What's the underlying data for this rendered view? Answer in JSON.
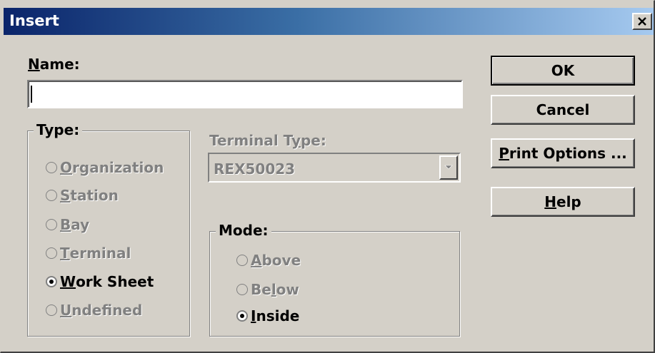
{
  "window": {
    "title": "Insert",
    "close_glyph": "✕"
  },
  "name_field": {
    "label_underlined": "N",
    "label_rest": "ame:",
    "value": ""
  },
  "type_group": {
    "title": "Type:",
    "options": [
      {
        "underlined": "O",
        "rest": "rganization",
        "selected": false,
        "enabled": false
      },
      {
        "underlined": "S",
        "rest": "tation",
        "selected": false,
        "enabled": false
      },
      {
        "underlined": "B",
        "rest": "ay",
        "selected": false,
        "enabled": false
      },
      {
        "underlined": "T",
        "rest": "erminal",
        "selected": false,
        "enabled": false
      },
      {
        "underlined": "W",
        "rest": "ork Sheet",
        "selected": true,
        "enabled": true
      },
      {
        "underlined": "U",
        "rest": "ndefined",
        "selected": false,
        "enabled": false
      }
    ]
  },
  "terminal_type": {
    "label_before": "Terminal T",
    "label_underlined": "y",
    "label_after": "pe:",
    "value": "REX50023"
  },
  "mode_group": {
    "title": "Mode:",
    "options": [
      {
        "before": "",
        "underlined": "A",
        "rest": "bove",
        "selected": false,
        "enabled": false
      },
      {
        "before": "Be",
        "underlined": "l",
        "rest": "ow",
        "selected": false,
        "enabled": false
      },
      {
        "before": "",
        "underlined": "I",
        "rest": "nside",
        "selected": true,
        "enabled": true
      }
    ]
  },
  "buttons": {
    "ok": "OK",
    "cancel": "Cancel",
    "print_underlined": "P",
    "print_rest": "rint Options ...",
    "help_underlined": "H",
    "help_rest": "elp"
  }
}
